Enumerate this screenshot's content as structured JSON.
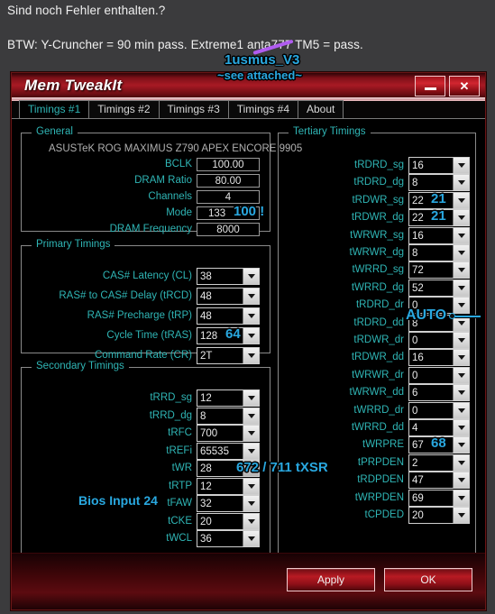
{
  "post": {
    "line1": "Sind noch Fehler enthalten.?",
    "line2": "BTW: Y-Cruncher = 90 min pass. Extreme1 anta777 TM5 = pass.",
    "annotation_handle": "1usmus_V3",
    "annotation_attached": "~see attached~"
  },
  "window": {
    "title": "Mem TweakIt",
    "minimize_label": "",
    "close_label": "✕"
  },
  "tabs": [
    {
      "label": "Timings #1",
      "active": true
    },
    {
      "label": "Timings #2",
      "active": false
    },
    {
      "label": "Timings #3",
      "active": false
    },
    {
      "label": "Timings #4",
      "active": false
    },
    {
      "label": "About",
      "active": false
    }
  ],
  "general": {
    "title": "General",
    "board": "ASUSTeK ROG MAXIMUS Z790 APEX ENCORE 9905",
    "rows": [
      {
        "label": "BCLK",
        "value": "100.00",
        "note": ""
      },
      {
        "label": "DRAM Ratio",
        "value": "80.00",
        "note": ""
      },
      {
        "label": "Channels",
        "value": "4",
        "note": ""
      },
      {
        "label": "Mode",
        "value": "133",
        "note": "100 !"
      },
      {
        "label": "DRAM Frequency",
        "value": "8000",
        "note": ""
      }
    ]
  },
  "primary": {
    "title": "Primary Timings",
    "rows": [
      {
        "label": "CAS# Latency (CL)",
        "value": "38",
        "note": ""
      },
      {
        "label": "RAS# to CAS# Delay (tRCD)",
        "value": "48",
        "note": ""
      },
      {
        "label": "RAS# Precharge (tRP)",
        "value": "48",
        "note": ""
      },
      {
        "label": "Cycle Time (tRAS)",
        "value": "128",
        "note": "64"
      },
      {
        "label": "Command Rate (CR)",
        "value": "2T",
        "note": ""
      }
    ]
  },
  "secondary": {
    "title": "Secondary Timings",
    "left_note": "Bios Input 24",
    "trfc_note": "672 / 711 tXSR",
    "rows": [
      {
        "label": "tRRD_sg",
        "value": "12",
        "note": ""
      },
      {
        "label": "tRRD_dg",
        "value": "8",
        "note": ""
      },
      {
        "label": "tRFC",
        "value": "700",
        "note": ""
      },
      {
        "label": "tREFi",
        "value": "65535",
        "note": ""
      },
      {
        "label": "tWR",
        "value": "28",
        "note": ""
      },
      {
        "label": "tRTP",
        "value": "12",
        "note": ""
      },
      {
        "label": "tFAW",
        "value": "32",
        "note": ""
      },
      {
        "label": "tCKE",
        "value": "20",
        "note": ""
      },
      {
        "label": "tWCL",
        "value": "36",
        "note": ""
      }
    ]
  },
  "tertiary": {
    "title": "Tertiary Timings",
    "auto_note": "AUTO",
    "rows": [
      {
        "label": "tRDRD_sg",
        "value": "16",
        "note": ""
      },
      {
        "label": "tRDRD_dg",
        "value": "8",
        "note": ""
      },
      {
        "label": "tRDWR_sg",
        "value": "22",
        "note": "21"
      },
      {
        "label": "tRDWR_dg",
        "value": "22",
        "note": "21"
      },
      {
        "label": "tWRWR_sg",
        "value": "16",
        "note": ""
      },
      {
        "label": "tWRWR_dg",
        "value": "8",
        "note": ""
      },
      {
        "label": "tWRRD_sg",
        "value": "72",
        "note": ""
      },
      {
        "label": "tWRRD_dg",
        "value": "52",
        "note": ""
      },
      {
        "label": "tRDRD_dr",
        "value": "0",
        "note": ""
      },
      {
        "label": "tRDRD_dd",
        "value": "8",
        "note": ""
      },
      {
        "label": "tRDWR_dr",
        "value": "0",
        "note": ""
      },
      {
        "label": "tRDWR_dd",
        "value": "16",
        "note": ""
      },
      {
        "label": "tWRWR_dr",
        "value": "0",
        "note": ""
      },
      {
        "label": "tWRWR_dd",
        "value": "6",
        "note": ""
      },
      {
        "label": "tWRRD_dr",
        "value": "0",
        "note": ""
      },
      {
        "label": "tWRRD_dd",
        "value": "4",
        "note": ""
      },
      {
        "label": "tWRPRE",
        "value": "67",
        "note": "68"
      },
      {
        "label": "tPRPDEN",
        "value": "2",
        "note": ""
      },
      {
        "label": "tRDPDEN",
        "value": "47",
        "note": ""
      },
      {
        "label": "tWRPDEN",
        "value": "69",
        "note": ""
      },
      {
        "label": "tCPDED",
        "value": "20",
        "note": ""
      }
    ]
  },
  "footer": {
    "apply_label": "Apply",
    "ok_label": "OK"
  },
  "colors": {
    "accent_cyan": "#2fb5b5",
    "annotation_blue": "#29a8e0",
    "brand_red": "#b81a23",
    "strike_purple": "#b05cf0"
  }
}
